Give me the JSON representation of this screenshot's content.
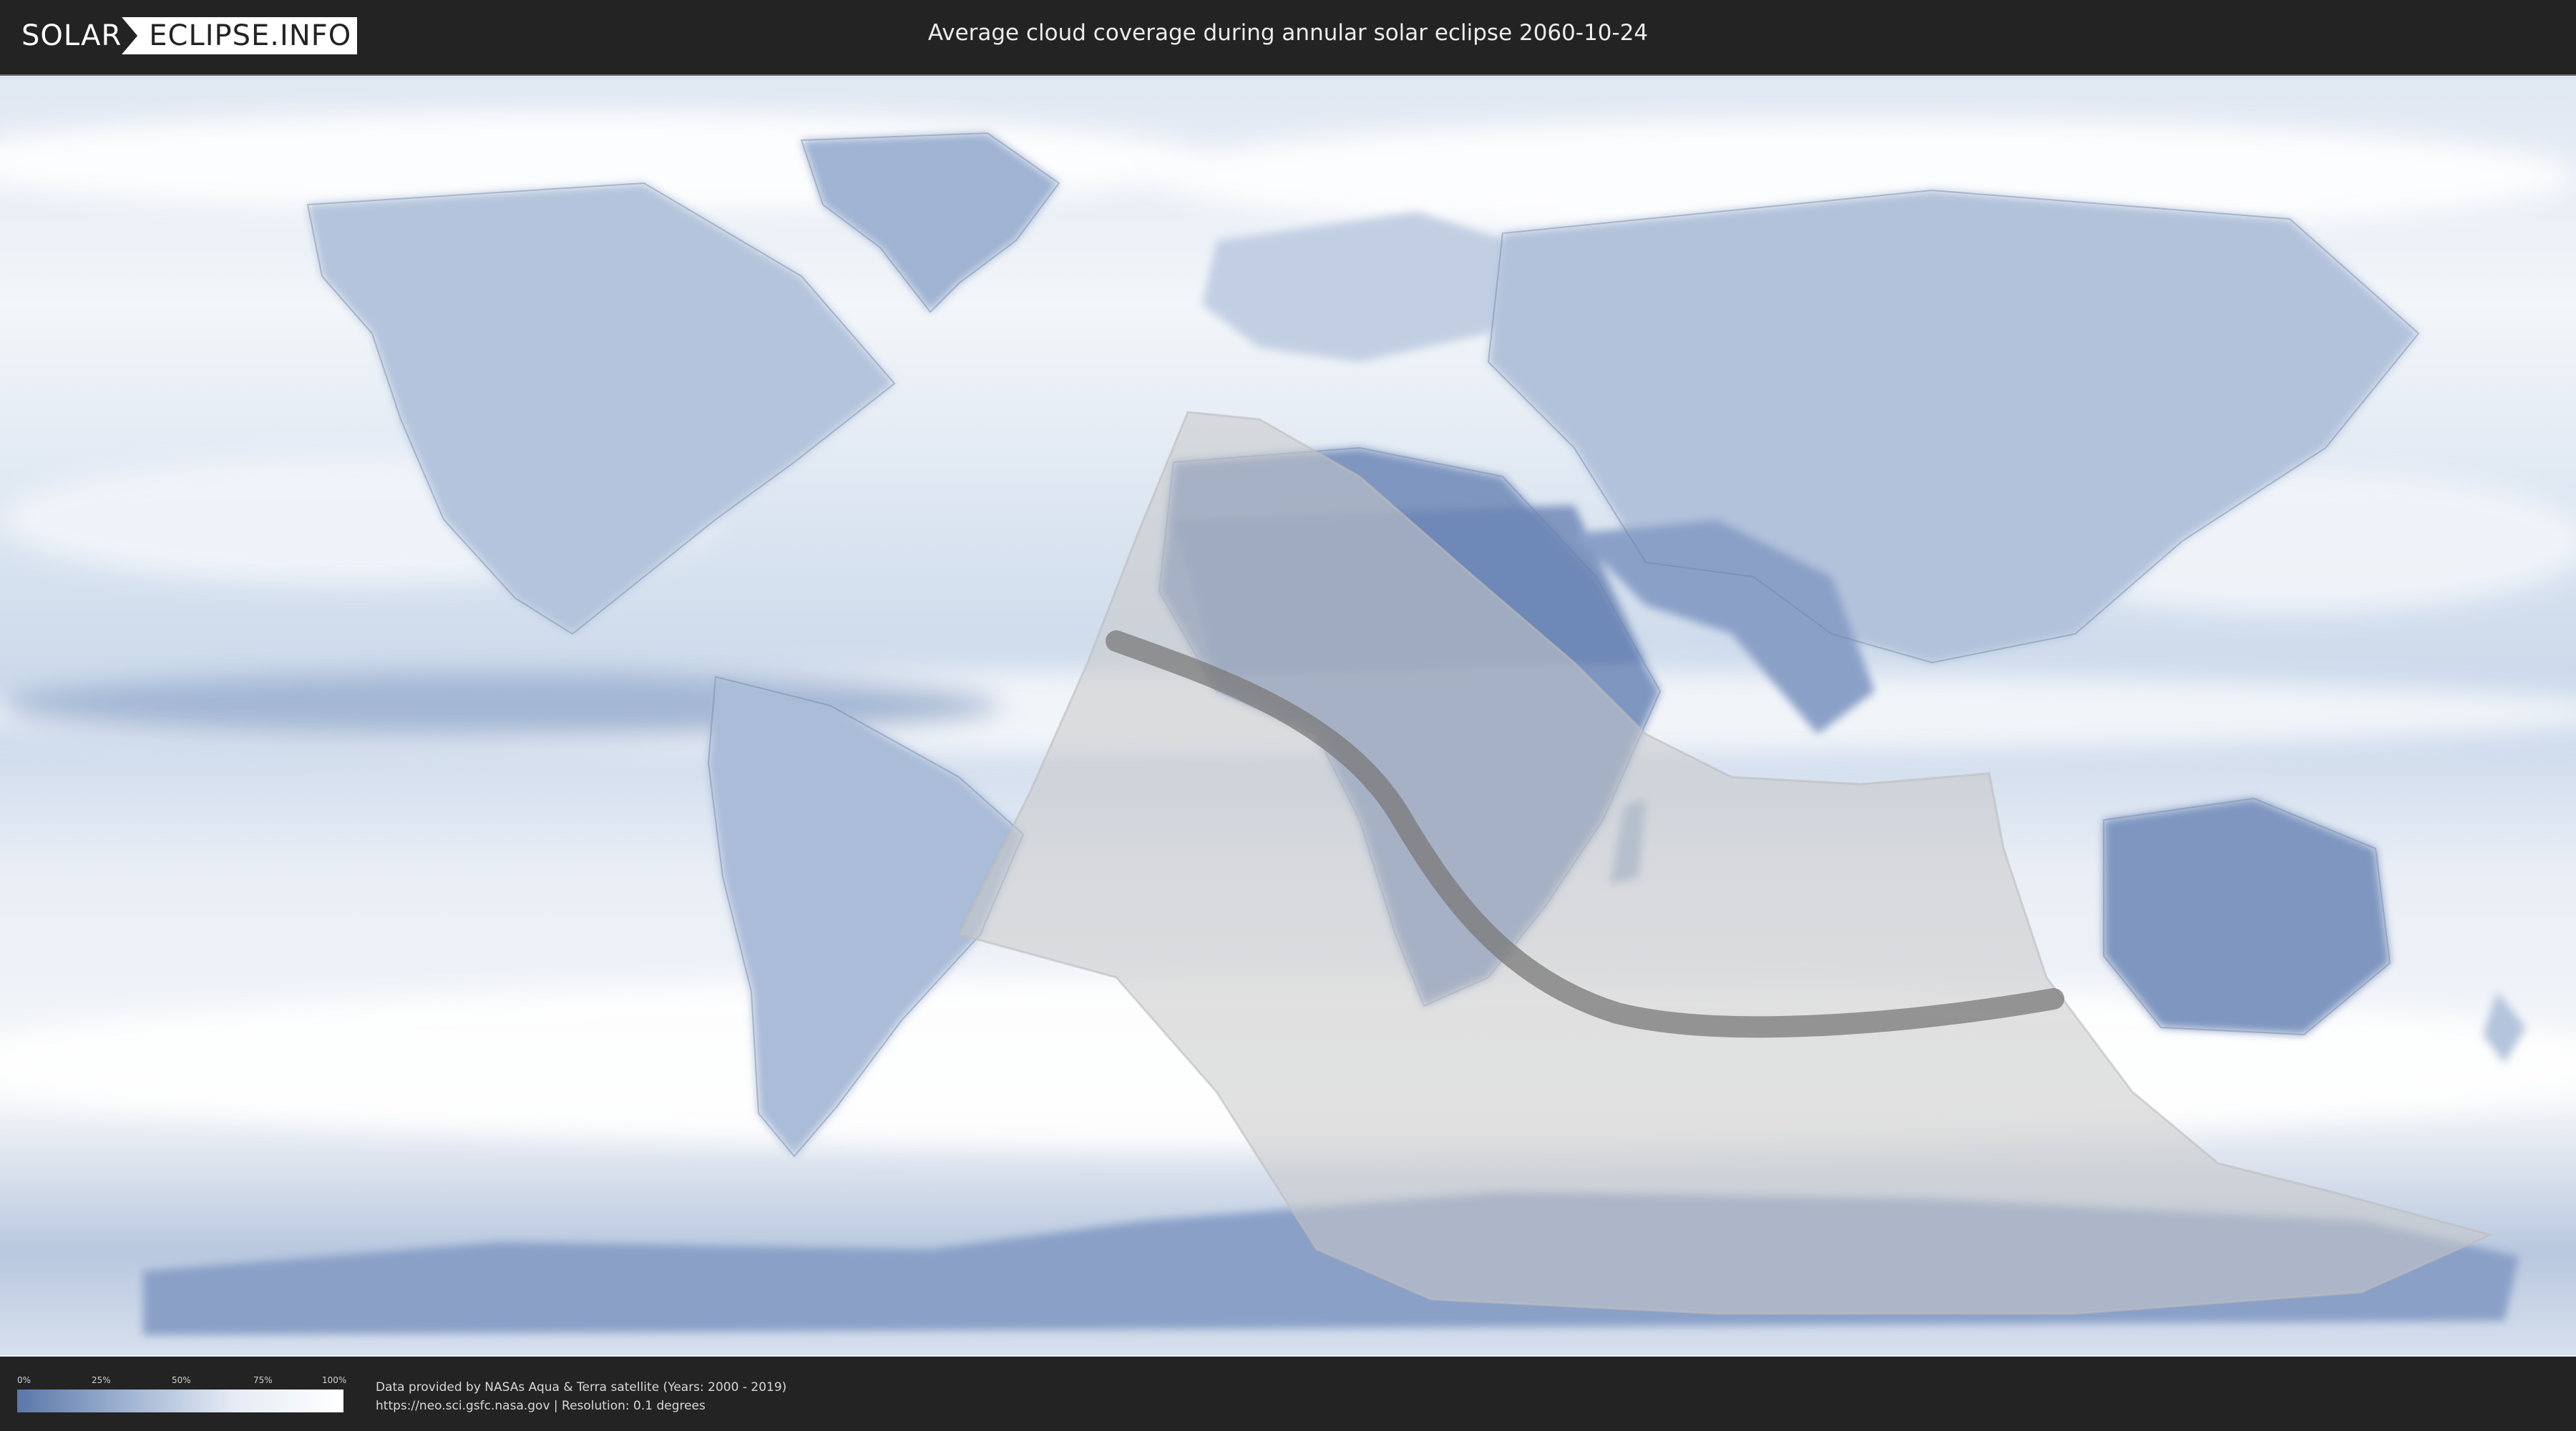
{
  "header": {
    "logo_left": "SOLAR",
    "logo_right": "ECLIPSE.INFO",
    "title": "Average cloud coverage during annular solar eclipse 2060-10-24"
  },
  "legend": {
    "ticks": [
      "0%",
      "25%",
      "50%",
      "75%",
      "100%"
    ],
    "gradient_colors": [
      "#5b77a8",
      "#9fb3d2",
      "#e6ecf5",
      "#ffffff"
    ]
  },
  "footer": {
    "credit_line1": "Data provided by NASAs Aqua & Terra satellite (Years: 2000 - 2019)",
    "credit_line2": "https://neo.sci.gsfc.nasa.gov | Resolution: 0.1 degrees"
  },
  "colors": {
    "background": "#232323",
    "cloud_clear": "#5b77a8",
    "cloud_full": "#ffffff",
    "eclipse_region": "#c8c8c8",
    "central_path": "#7a7a7a"
  }
}
